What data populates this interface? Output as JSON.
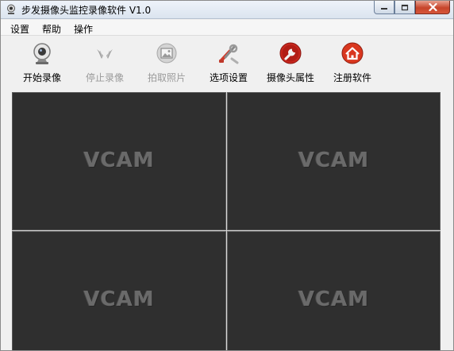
{
  "window": {
    "title": "步发摄像头监控录像软件 V1.0"
  },
  "menu": {
    "items": [
      {
        "label": "设置"
      },
      {
        "label": "帮助"
      },
      {
        "label": "操作"
      }
    ]
  },
  "toolbar": {
    "buttons": [
      {
        "label": "开始录像",
        "icon": "webcam-icon",
        "enabled": true
      },
      {
        "label": "停止录像",
        "icon": "stop-wings-icon",
        "enabled": false
      },
      {
        "label": "拍取照片",
        "icon": "photo-icon",
        "enabled": false
      },
      {
        "label": "选项设置",
        "icon": "tools-icon",
        "enabled": true
      },
      {
        "label": "摄像头属性",
        "icon": "wrench-icon",
        "enabled": true
      },
      {
        "label": "注册软件",
        "icon": "home-icon",
        "enabled": true
      }
    ]
  },
  "video": {
    "panes": [
      {
        "label": "VCAM"
      },
      {
        "label": "VCAM"
      },
      {
        "label": "VCAM"
      },
      {
        "label": "VCAM"
      }
    ]
  },
  "colors": {
    "pane_background": "#2f2f2f",
    "close_button": "#c7452b"
  }
}
